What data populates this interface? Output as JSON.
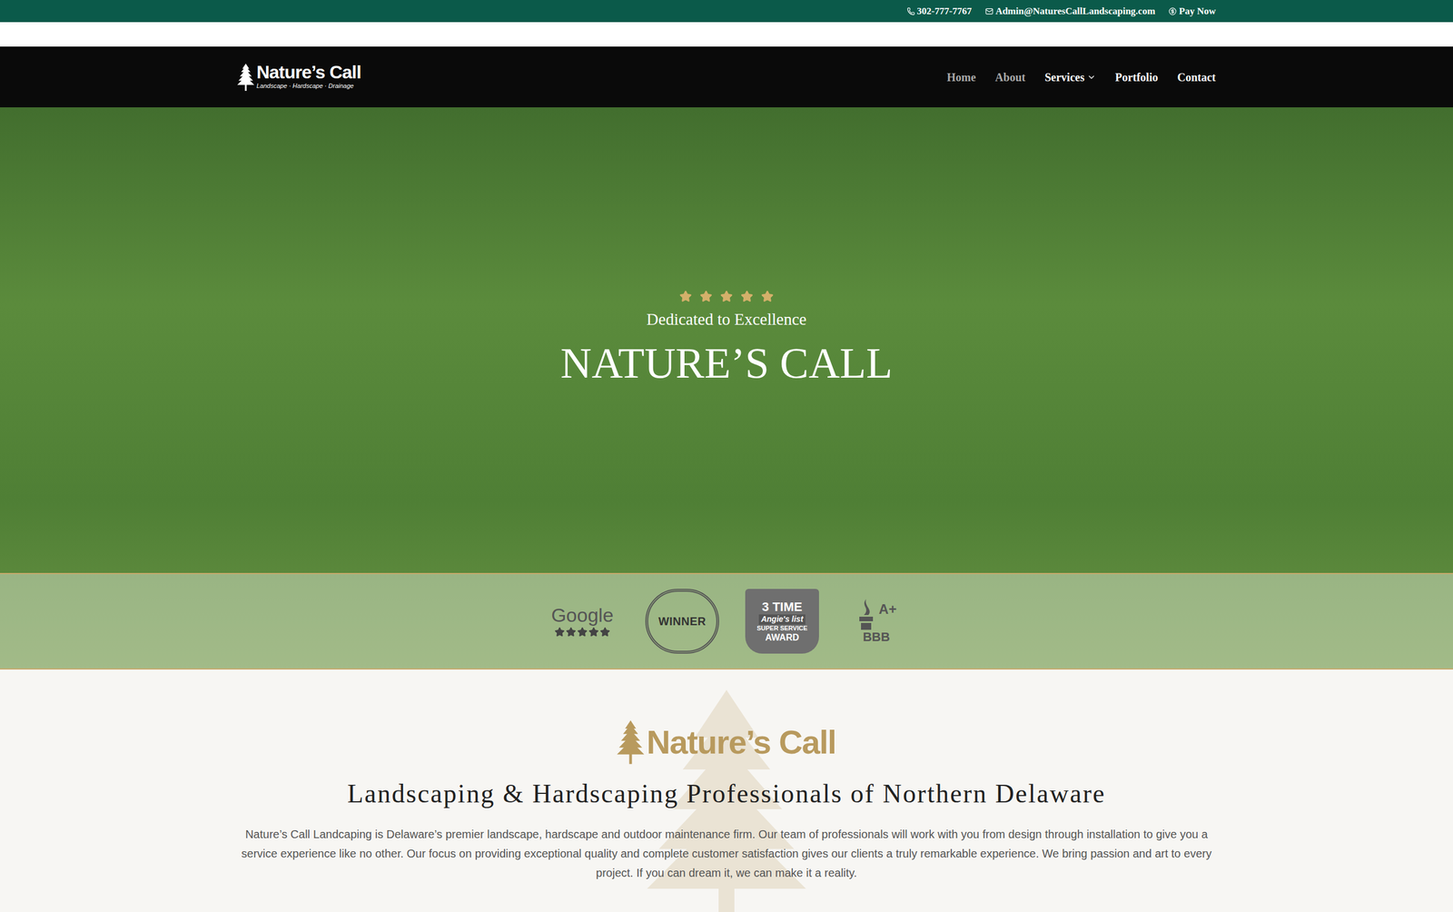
{
  "top_bar": {
    "phone": "302-777-7767",
    "email": "Admin@NaturesCallLandscaping.com",
    "pay": "Pay Now"
  },
  "nav": {
    "logo": {
      "name": "Nature’s Call",
      "tagline": "Landscape · Hardscape · Drainage"
    },
    "items": [
      {
        "label": "Home",
        "muted": true,
        "dropdown": false
      },
      {
        "label": "About",
        "muted": true,
        "dropdown": false
      },
      {
        "label": "Services",
        "muted": false,
        "dropdown": true
      },
      {
        "label": "Portfolio",
        "muted": false,
        "dropdown": false
      },
      {
        "label": "Contact",
        "muted": false,
        "dropdown": false
      }
    ]
  },
  "hero": {
    "stars": 5,
    "subtitle": "Dedicated to Excellence",
    "title": "NATURE’S CALL"
  },
  "badges": [
    {
      "kind": "google",
      "lines": [
        "Google"
      ],
      "stars": 5
    },
    {
      "kind": "laurel",
      "lines": [
        "WINNER"
      ],
      "stars": 0
    },
    {
      "kind": "angies",
      "lines": [
        "3 TIME",
        "Angie's list",
        "SUPER SERVICE",
        "AWARD"
      ],
      "stars": 0
    },
    {
      "kind": "bbb",
      "lines": [
        "A+",
        "BBB"
      ],
      "stars": 0
    }
  ],
  "intro": {
    "logo": "Nature’s Call",
    "heading": "Landscaping & Hardscaping Professionals of Northern Delaware",
    "body": "Nature’s Call Landcaping is Delaware’s premier landscape, hardscape and outdoor maintenance firm. Our team of professionals will work with you from design through installation to give you a service experience like no other. Our focus on providing exceptional quality and complete customer satisfaction gives our clients a truly remarkable experience. We bring passion and art to every project. If you can dream it, we can make it a reality.",
    "cta_buttons": [
      {
        "color": "#222222"
      },
      {
        "color": "#0b5a4a"
      }
    ]
  }
}
